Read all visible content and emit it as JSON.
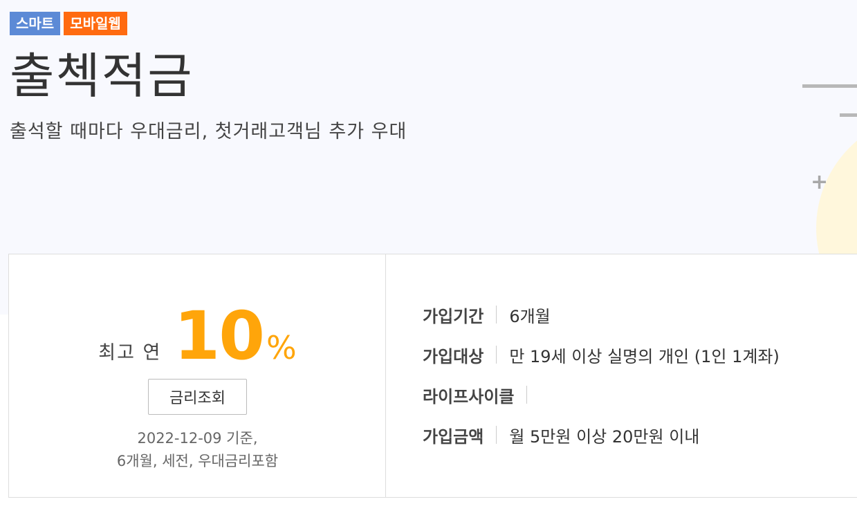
{
  "badges": {
    "smart": "스마트",
    "mobile": "모바일웹"
  },
  "product": {
    "title": "출첵적금",
    "subtitle": "출석할 때마다 우대금리, 첫거래고객님 추가 우대"
  },
  "rate": {
    "prefix": "최고 연",
    "value": "10",
    "unit": "%",
    "button_label": "금리조회",
    "note_line1": "2022-12-09 기준,",
    "note_line2": "6개월, 세전, 우대금리포함"
  },
  "details": [
    {
      "label": "가입기간",
      "value": "6개월"
    },
    {
      "label": "가입대상",
      "value": "만 19세 이상 실명의 개인 (1인 1계좌)"
    },
    {
      "label": "라이프사이클",
      "value": ""
    },
    {
      "label": "가입금액",
      "value": "월 5만원 이상 20만원 이내"
    }
  ],
  "colors": {
    "accent_orange": "#ffa50a",
    "badge_smart": "#5c8ad6",
    "badge_mobile": "#ff6b10",
    "hero_background": "#f8f9fe"
  }
}
